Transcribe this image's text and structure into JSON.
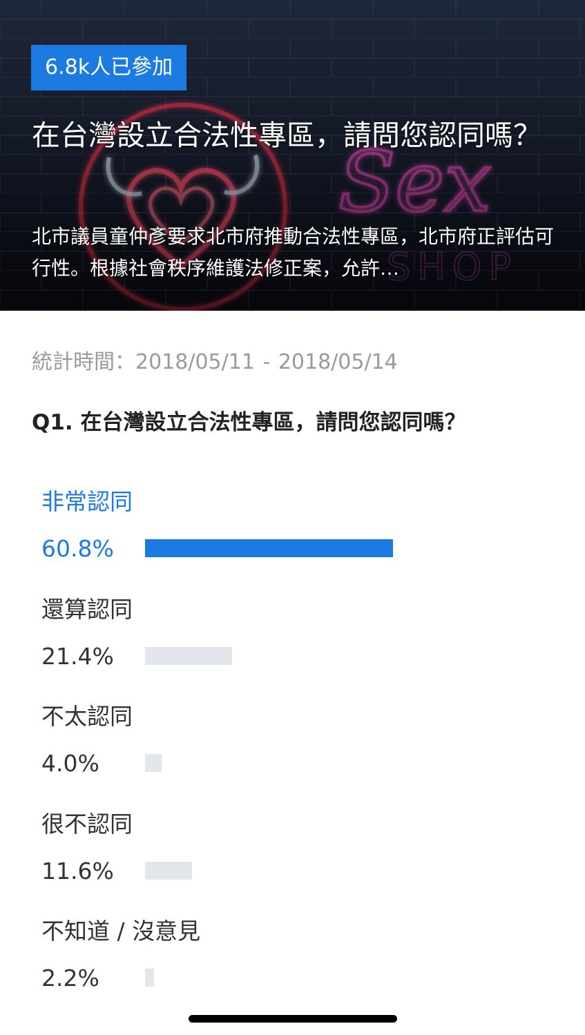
{
  "colors": {
    "accent": "#1b7be0",
    "bar_inactive": "#e3e6ea",
    "text_primary": "#222222",
    "text_muted": "#9a9a9a"
  },
  "hero": {
    "badge": "6.8k人已參加",
    "title": "在台灣設立合法性專區，請問您認同嗎？",
    "description": "北市議員童仲彥要求北市府推動合法性專區，北市府正評估可行性。根據社會秩序維護法修正案，允許…",
    "image_neon_text": "Sex",
    "image_neon_subtext": "SHOP"
  },
  "survey": {
    "stats_label": "統計時間：",
    "start_date": "2018/05/11",
    "date_separator": "-",
    "end_date": "2018/05/14",
    "question": "Q1. 在台灣設立合法性專區，請問您認同嗎？",
    "options": [
      {
        "label": "非常認同",
        "percent_text": "60.8%",
        "percent": 60.8,
        "selected": true
      },
      {
        "label": "還算認同",
        "percent_text": "21.4%",
        "percent": 21.4,
        "selected": false
      },
      {
        "label": "不太認同",
        "percent_text": "4.0%",
        "percent": 4.0,
        "selected": false
      },
      {
        "label": "很不認同",
        "percent_text": "11.6%",
        "percent": 11.6,
        "selected": false
      },
      {
        "label": "不知道 / 沒意見",
        "percent_text": "2.2%",
        "percent": 2.2,
        "selected": false
      }
    ]
  }
}
